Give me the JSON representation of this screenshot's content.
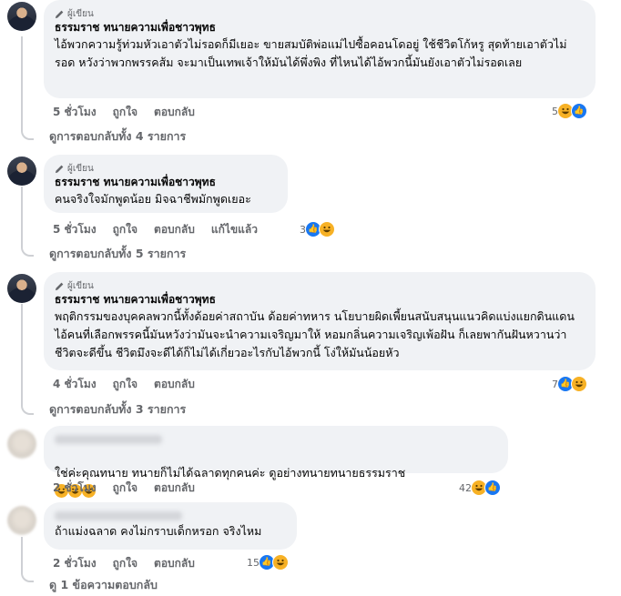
{
  "badge_label": "ผู้เขียน",
  "comments": [
    {
      "author": "ธรรมราช ทนายความเพื่อชาวพุทธ",
      "text": "ไอ้พวกความรู้ท่วมหัวเอาตัวไม่รอดก็มีเยอะ ขายสมบัติพ่อแม่ไปซื้อคอนโดอยู่ ใช้ชีวิตโก้หรู สุดท้ายเอาตัวไม่รอด หวังว่าพวกพรรคส้ม จะมาเป็นเทพเจ้าให้มันได้พึ่งพิง ที่ไหนได้ไอ้พวกนี้มันยังเอาตัวไม่รอดเลย",
      "time": "5 ชั่วโมง",
      "like": "ถูกใจ",
      "reply": "ตอบกลับ",
      "reaction_count": "5",
      "view_replies": "ดูการตอบกลับทั้ง 4 รายการ"
    },
    {
      "author": "ธรรมราช ทนายความเพื่อชาวพุทธ",
      "text": "คนจริงใจมักพูดน้อย มิจฉาชีพมักพูดเยอะ",
      "time": "5 ชั่วโมง",
      "like": "ถูกใจ",
      "reply": "ตอบกลับ",
      "edited": "แก้ไขแล้ว",
      "reaction_count": "3",
      "view_replies": "ดูการตอบกลับทั้ง 5 รายการ"
    },
    {
      "author": "ธรรมราช ทนายความเพื่อชาวพุทธ",
      "text": "พฤติกรรมของบุคคลพวกนี้ทั้งด้อยค่าสถาบัน ด้อยค่าทหาร นโยบายผิดเพี้ยนสนับสนุนแนวคิดแบ่งแยกดินแดน ไอ้คนที่เลือกพรรคนี้มันหวังว่ามันจะนำความเจริญมาให้ หอมกลิ่นความเจริญเพ้อฝัน ก็เลยพากันฝันหวานว่าชีวิตจะดีขึ้น ชีวิตมึงจะดีได้ก็ไม่ได้เกี่ยวอะไรกับไอ้พวกนี้ โง่ให้มันน้อยหัว",
      "time": "4 ชั่วโมง",
      "like": "ถูกใจ",
      "reply": "ตอบกลับ",
      "reaction_count": "7",
      "view_replies": "ดูการตอบกลับทั้ง 3 รายการ"
    },
    {
      "text": "ใช่ค่ะคุณทนาย ทนายก็ไม่ได้ฉลาดทุกคนค่ะ ดูอย่างทนายทนายธรรมราช",
      "time": "2 ชั่วโมง",
      "like": "ถูกใจ",
      "reply": "ตอบกลับ",
      "reaction_count": "42"
    },
    {
      "text": "ถ้าแม่งฉลาด คงไม่กราบเด็กหรอก จริงไหม",
      "time": "2 ชั่วโมง",
      "like": "ถูกใจ",
      "reply": "ตอบกลับ",
      "reaction_count": "15",
      "view_replies": "ดู 1 ข้อความตอบกลับ"
    }
  ],
  "colors": {
    "bubble": "#f0f2f5",
    "meta": "#65676b",
    "like_blue": "#1877f2",
    "haha_yellow": "#f7b125"
  },
  "icons": {
    "badge": "pencil-icon",
    "like": "like-reaction-icon",
    "haha": "haha-reaction-icon"
  }
}
